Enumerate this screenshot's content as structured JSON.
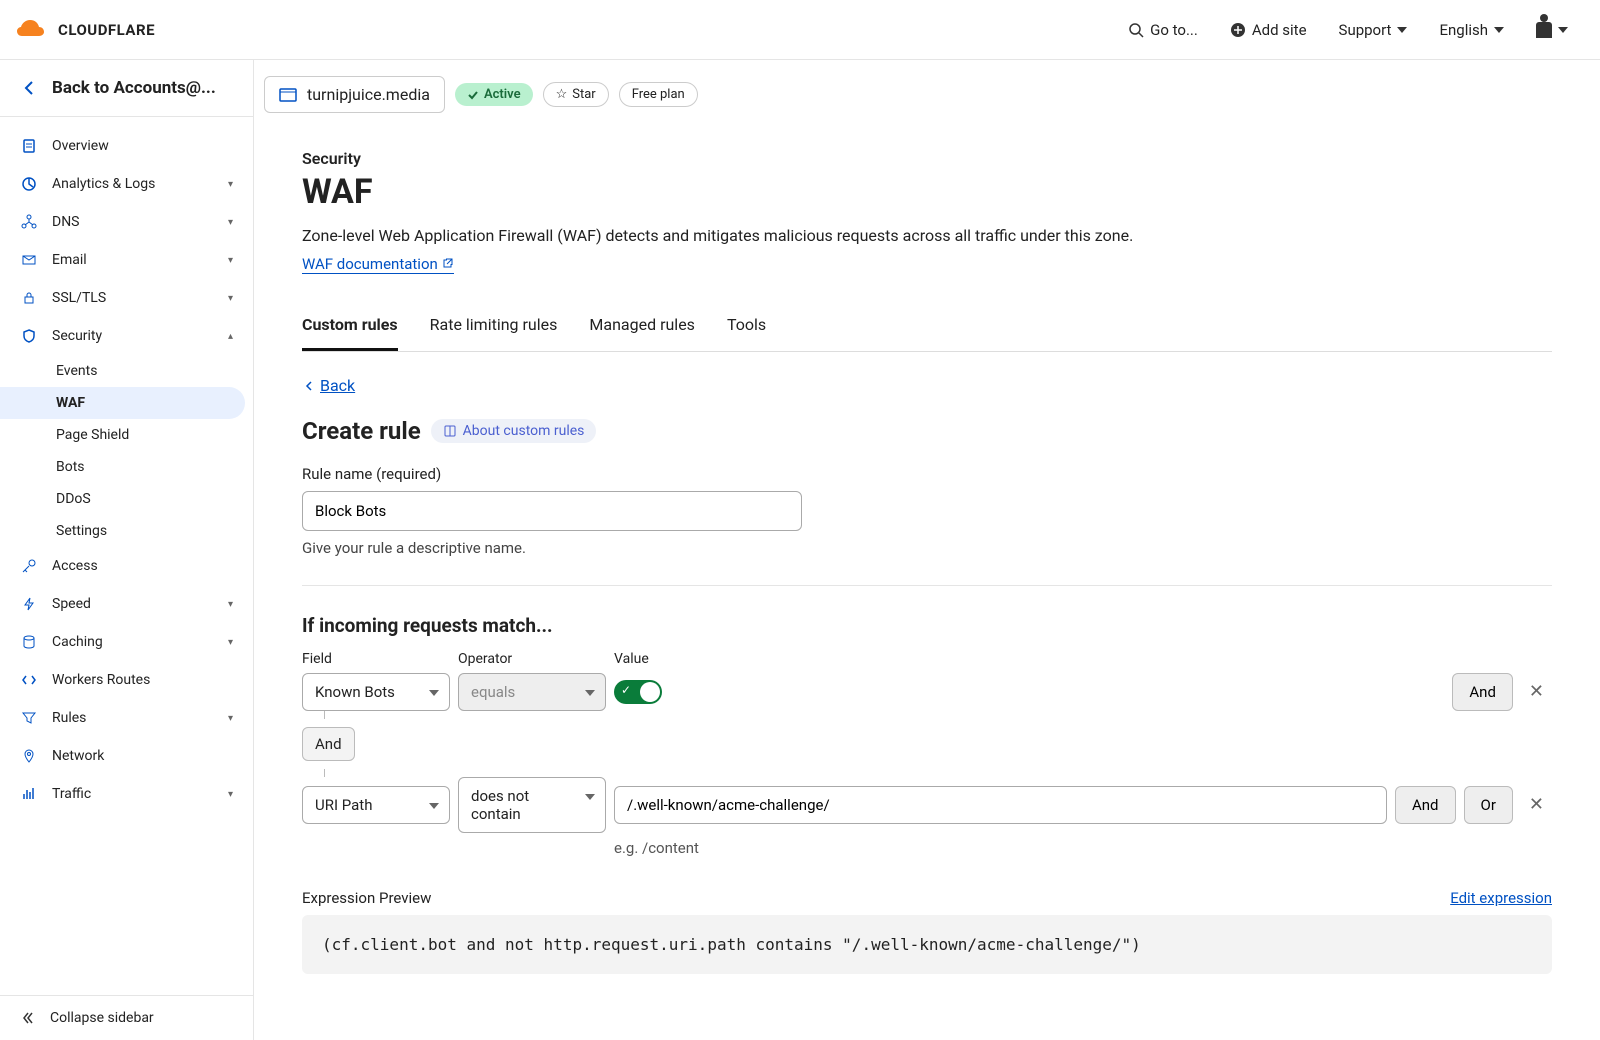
{
  "topbar": {
    "goto": "Go to...",
    "add_site": "Add site",
    "support": "Support",
    "language": "English"
  },
  "sidebar": {
    "back_label": "Back to Accounts@...",
    "items": [
      {
        "label": "Overview"
      },
      {
        "label": "Analytics & Logs"
      },
      {
        "label": "DNS"
      },
      {
        "label": "Email"
      },
      {
        "label": "SSL/TLS"
      },
      {
        "label": "Security"
      },
      {
        "label": "Access"
      },
      {
        "label": "Speed"
      },
      {
        "label": "Caching"
      },
      {
        "label": "Workers Routes"
      },
      {
        "label": "Rules"
      },
      {
        "label": "Network"
      },
      {
        "label": "Traffic"
      }
    ],
    "security_sub": [
      "Events",
      "WAF",
      "Page Shield",
      "Bots",
      "DDoS",
      "Settings"
    ],
    "collapse": "Collapse sidebar"
  },
  "site": {
    "domain": "turnipjuice.media",
    "status": "Active",
    "star": "Star",
    "plan": "Free plan"
  },
  "page": {
    "breadcrumb": "Security",
    "title": "WAF",
    "description": "Zone-level Web Application Firewall (WAF) detects and mitigates malicious requests across all traffic under this zone.",
    "doc_link": "WAF documentation"
  },
  "tabs": [
    "Custom rules",
    "Rate limiting rules",
    "Managed rules",
    "Tools"
  ],
  "back": "Back",
  "create": {
    "title": "Create rule",
    "about": "About custom rules",
    "name_label": "Rule name (required)",
    "name_value": "Block Bots",
    "name_hint": "Give your rule a descriptive name."
  },
  "match": {
    "title": "If incoming requests match...",
    "field_label": "Field",
    "operator_label": "Operator",
    "value_label": "Value",
    "row1": {
      "field": "Known Bots",
      "operator": "equals"
    },
    "join": "And",
    "row2": {
      "field": "URI Path",
      "operator": "does not contain",
      "value": "/.well-known/acme-challenge/",
      "hint": "e.g. /content"
    },
    "and_btn": "And",
    "or_btn": "Or"
  },
  "expr": {
    "label": "Expression Preview",
    "edit": "Edit expression",
    "code": "(cf.client.bot and not http.request.uri.path contains \"/.well-known/acme-challenge/\")"
  },
  "logo_text": "CLOUDFLARE"
}
